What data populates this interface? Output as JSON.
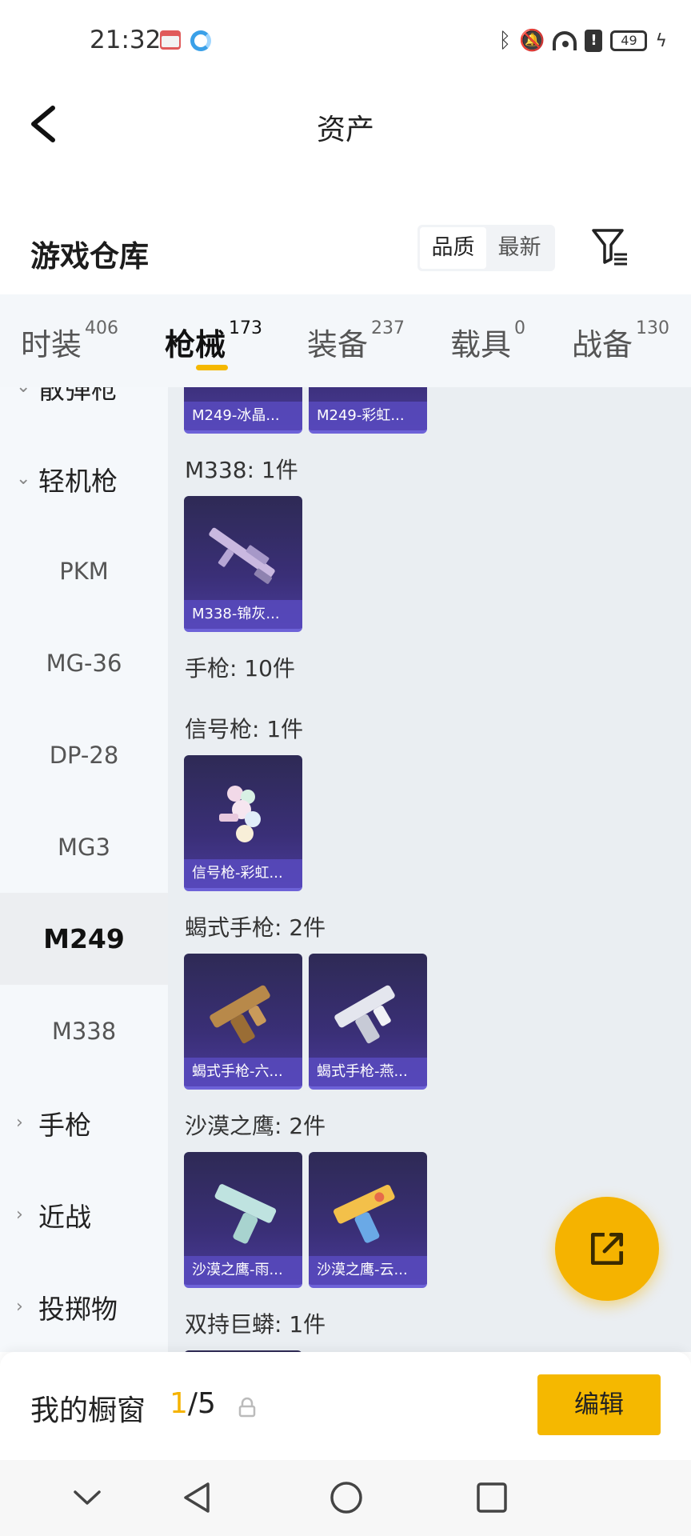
{
  "status_bar": {
    "time": "21:32",
    "battery": "49"
  },
  "header": {
    "title": "资产"
  },
  "warehouse": {
    "title": "游戏仓库",
    "sort_options": [
      "品质",
      "最新"
    ]
  },
  "tabs": [
    {
      "label": "时装",
      "count": "406"
    },
    {
      "label": "枪械",
      "count": "173"
    },
    {
      "label": "装备",
      "count": "237"
    },
    {
      "label": "载具",
      "count": "0"
    },
    {
      "label": "战备",
      "count": "130"
    }
  ],
  "sidebar": {
    "partial_item": "散弹枪",
    "group_lmg": "轻机枪",
    "items": [
      "PKM",
      "MG-36",
      "DP-28",
      "MG3",
      "M249",
      "M338"
    ],
    "group_pistol": "手枪",
    "group_melee": "近战",
    "group_throw": "投掷物"
  },
  "content": {
    "top_cards": [
      "M249-冰晶...",
      "M249-彩虹..."
    ],
    "sections": [
      {
        "title": "M338: 1件",
        "cards": [
          "M338-锦灰..."
        ]
      },
      {
        "title": "手枪: 10件",
        "cards": []
      },
      {
        "title": "信号枪: 1件",
        "cards": [
          "信号枪-彩虹..."
        ]
      },
      {
        "title": "蝎式手枪: 2件",
        "cards": [
          "蝎式手枪-六...",
          "蝎式手枪-燕..."
        ]
      },
      {
        "title": "沙漠之鹰: 2件",
        "cards": [
          "沙漠之鹰-雨...",
          "沙漠之鹰-云..."
        ]
      },
      {
        "title": "双持巨蟒: 1件",
        "cards": []
      }
    ]
  },
  "showcase": {
    "title": "我的橱窗",
    "current": "1",
    "total": "/5",
    "edit_label": "编辑"
  },
  "colors": {
    "accent": "#f5b800",
    "card_bg": "#3a2f77"
  }
}
